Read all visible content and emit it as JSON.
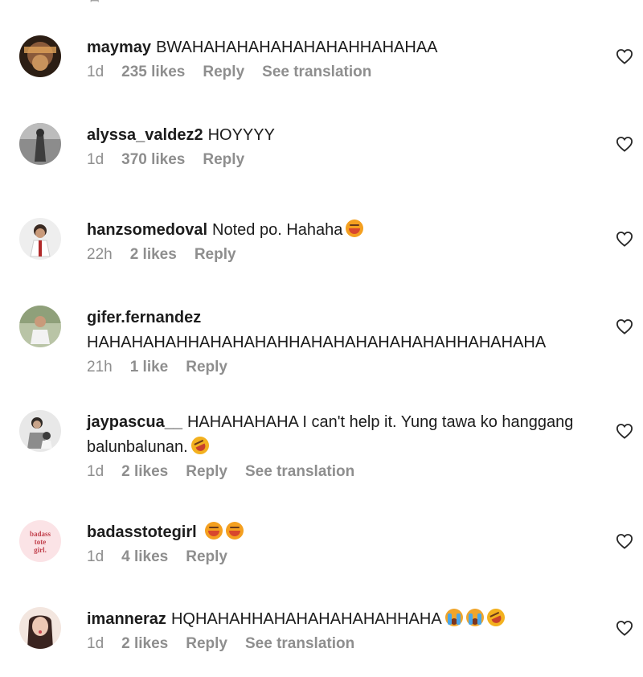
{
  "top_mark": "ꟷ",
  "comments": [
    {
      "username": "maymay",
      "text": "BWAHAHAHAHAHAHAHAHHAHAHAA",
      "time": "1d",
      "likes": "235 likes",
      "reply": "Reply",
      "translation": "See translation",
      "avatar_color": "#8a5a3a"
    },
    {
      "username": "alyssa_valdez2",
      "text": "HOYYYY",
      "time": "1d",
      "likes": "370 likes",
      "reply": "Reply",
      "avatar_color": "#6e6e6e"
    },
    {
      "username": "hanzsomedoval",
      "text": "Noted po. Hahaha",
      "time": "22h",
      "likes": "2 likes",
      "reply": "Reply",
      "emojis": [
        "laugh"
      ],
      "avatar_color": "#d9dadc"
    },
    {
      "username": "gifer.fernandez",
      "text": "HAHAHAHAHHAHAHAHAHHAHAHAHAHAHAHAHHAHAHAHA",
      "time": "21h",
      "likes": "1 like",
      "reply": "Reply",
      "avatar_color": "#a7b39a"
    },
    {
      "username": "jaypascua__",
      "text": "HAHAHAHAHA I can't help it. Yung tawa ko hanggang balunbalunan.",
      "time": "1d",
      "likes": "2 likes",
      "reply": "Reply",
      "translation": "See translation",
      "emojis": [
        "rofl"
      ],
      "avatar_color": "#c9c9c9"
    },
    {
      "username": "badasstotegirl",
      "text": "",
      "time": "1d",
      "likes": "4 likes",
      "reply": "Reply",
      "emojis": [
        "laugh",
        "laugh"
      ],
      "avatar_text": "badass tote girl",
      "avatar_color": "#fbe3e6"
    },
    {
      "username": "imanneraz",
      "text": "HQHAHAHHAHAHAHAHAHAHHAHA",
      "time": "1d",
      "likes": "2 likes",
      "reply": "Reply",
      "translation": "See translation",
      "emojis": [
        "sob",
        "sob",
        "rofl"
      ],
      "avatar_color": "#e6cfc4"
    }
  ],
  "icons": {
    "heart": "heart-outline-icon"
  }
}
